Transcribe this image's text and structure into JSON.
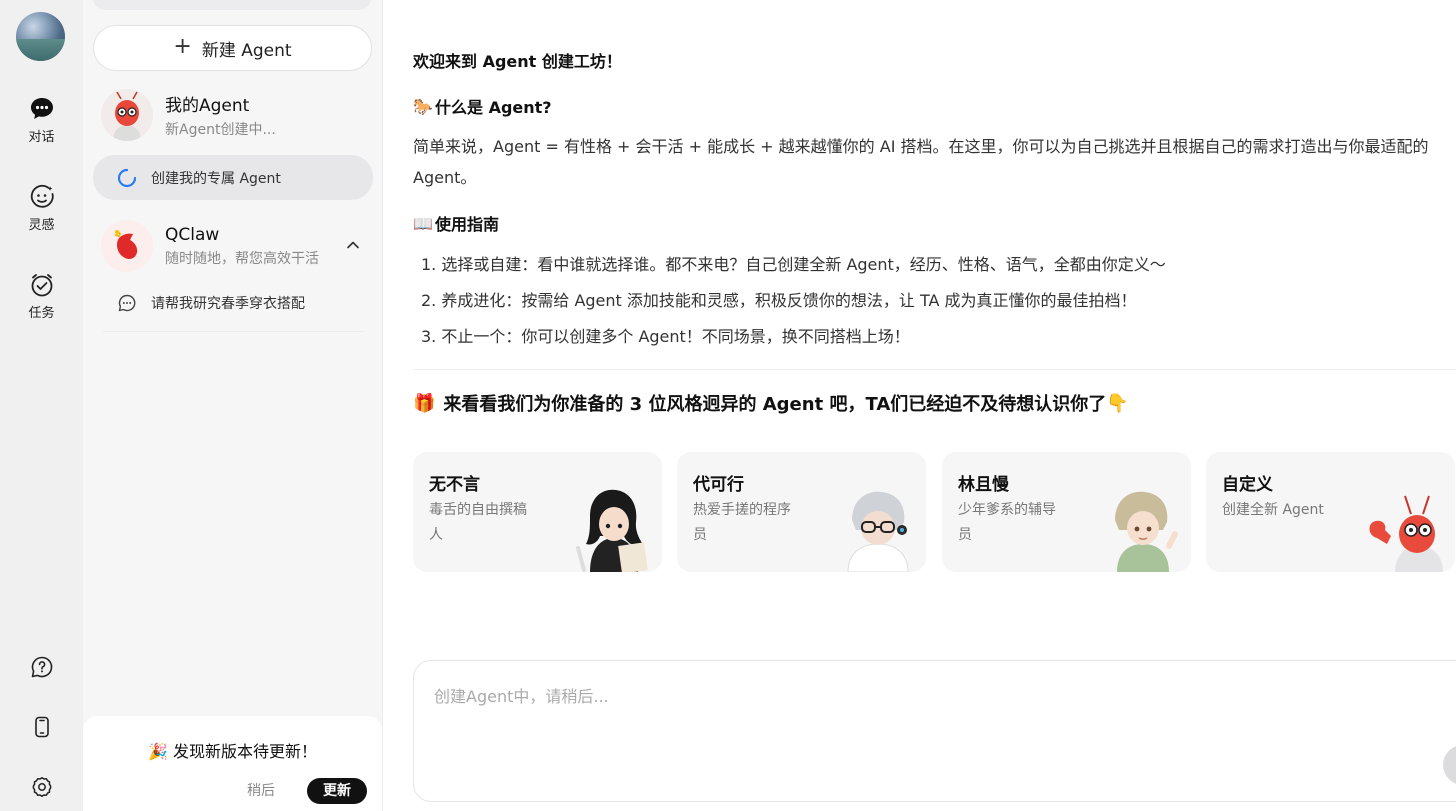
{
  "rail": {
    "items": [
      {
        "label": "对话",
        "icon": "chat-icon"
      },
      {
        "label": "灵感",
        "icon": "inspiration-icon"
      },
      {
        "label": "任务",
        "icon": "task-icon"
      }
    ],
    "bottom_icons": [
      "help-icon",
      "phone-icon",
      "settings-icon"
    ]
  },
  "panel": {
    "new_agent_label": "新建 Agent",
    "groups": [
      {
        "title": "我的Agent",
        "subtitle": "新Agent创建中...",
        "sessions": [
          {
            "label": "创建我的专属 Agent",
            "active": true
          }
        ]
      },
      {
        "title": "QClaw",
        "subtitle": "随时随地，帮您高效干活",
        "sessions": [
          {
            "label": "请帮我研究春季穿衣搭配",
            "active": false
          }
        ]
      }
    ],
    "update": {
      "emoji": "🎉",
      "title": "发现新版本待更新！",
      "later": "稍后",
      "confirm": "更新"
    }
  },
  "main": {
    "welcome": "欢迎来到 Agent 创建工坊！",
    "what_title": "什么是 Agent?",
    "what_emoji": "🐎",
    "what_body": "简单来说，Agent = 有性格 + 会干活 + 能成长 + 越来越懂你的 AI 搭档。在这里，你可以为自己挑选并且根据自己的需求打造出与你最适配的 Agent。",
    "guide_title": "使用指南",
    "guide_emoji": "📖",
    "guide_items": [
      "1. 选择或自建：看中谁就选择谁。都不来电？自己创建全新 Agent，经历、性格、语气，全都由你定义～",
      "2. 养成进化：按需给 Agent 添加技能和灵感，积极反馈你的想法，让 TA 成为真正懂你的最佳拍档！",
      "3. 不止一个：你可以创建多个 Agent！不同场景，换不同搭档上场！"
    ],
    "cards_title": "来看看我们为你准备的 3 位风格迥异的 Agent 吧，TA们已经迫不及待想认识你了",
    "cards_emoji_left": "🎁",
    "cards_emoji_right": "👇",
    "cards": [
      {
        "name": "无不言",
        "desc": "毒舌的自由撰稿人"
      },
      {
        "name": "代可行",
        "desc": "热爱手搓的程序员"
      },
      {
        "name": "林且慢",
        "desc": "少年爹系的辅导员"
      },
      {
        "name": "自定义",
        "desc": "创建全新 Agent"
      }
    ],
    "input_placeholder": "创建Agent中，请稍后..."
  }
}
